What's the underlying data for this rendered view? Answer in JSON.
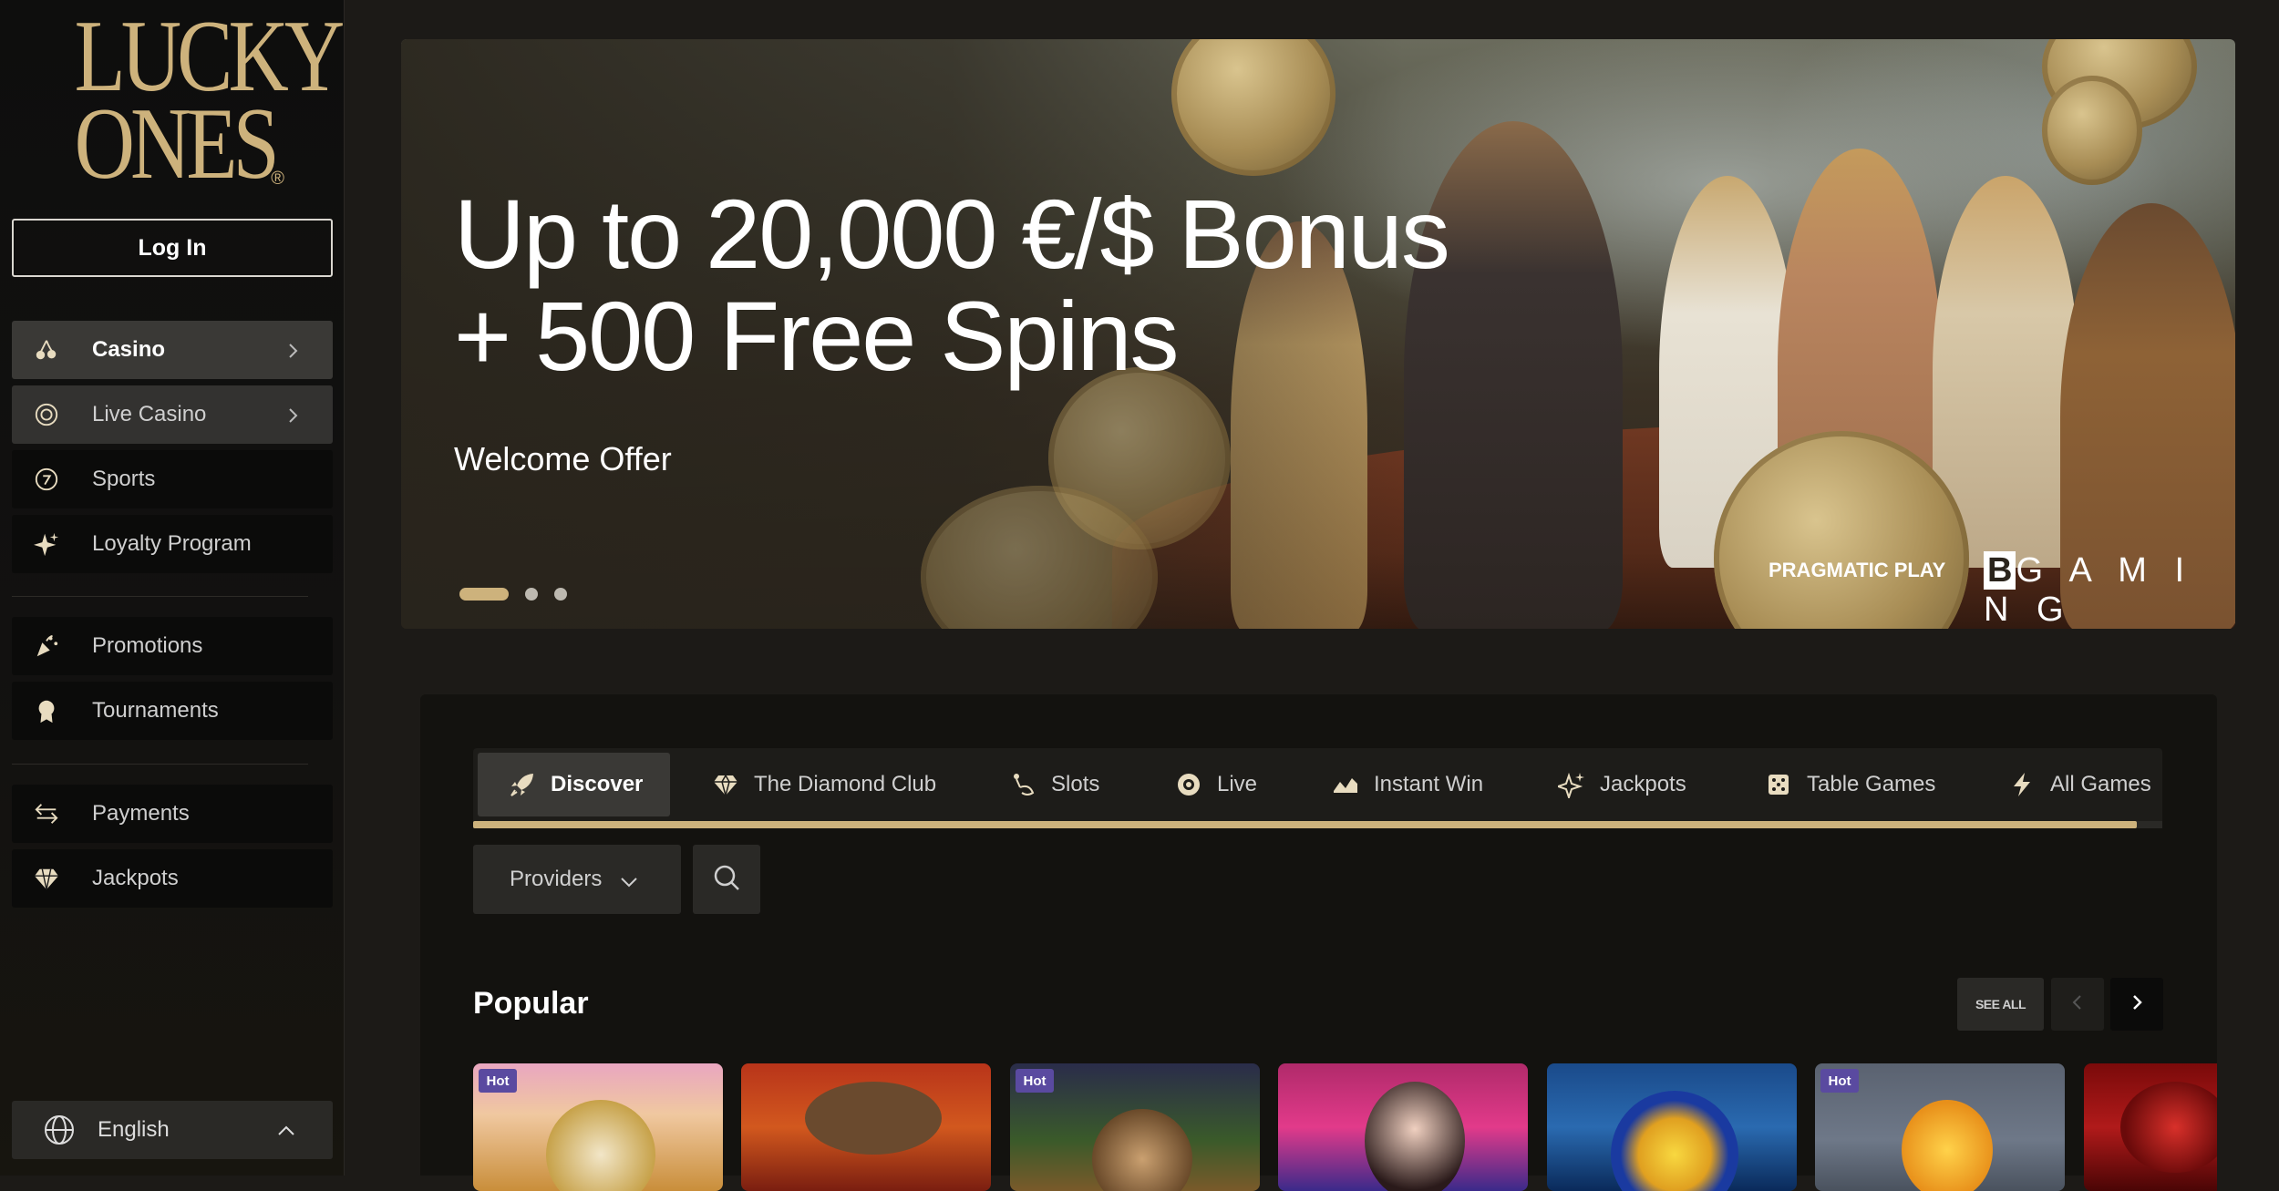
{
  "brand": {
    "logo_line1": "LUCKY",
    "logo_line2": "ONES",
    "logo_reg": "®"
  },
  "sidebar": {
    "login_label": "Log In",
    "items": [
      {
        "label": "Casino",
        "icon": "cherries-icon"
      },
      {
        "label": "Live Casino",
        "icon": "chip-icon"
      },
      {
        "label": "Sports",
        "icon": "sports-ball-icon"
      },
      {
        "label": "Loyalty Program",
        "icon": "sparkle-icon"
      },
      {
        "label": "Promotions",
        "icon": "confetti-icon"
      },
      {
        "label": "Tournaments",
        "icon": "medal-icon"
      },
      {
        "label": "Payments",
        "icon": "transfer-arrows-icon"
      },
      {
        "label": "Jackpots",
        "icon": "diamond-icon"
      }
    ],
    "language": "English"
  },
  "hero": {
    "title_line1": "Up to 20,000 €/$ Bonus",
    "title_line2": "+ 500 Free Spins",
    "subtitle": "Welcome Offer",
    "slide_count": 3,
    "active_slide": 1,
    "provider_logo_1": "PRAGMATIC PLAY",
    "provider_logo_2_initial": "B",
    "provider_logo_2_rest": "G A M I N G"
  },
  "tabs": [
    {
      "label": "Discover",
      "icon": "rocket-icon"
    },
    {
      "label": "The Diamond Club",
      "icon": "diamond-icon"
    },
    {
      "label": "Slots",
      "icon": "slot-lever-icon"
    },
    {
      "label": "Live",
      "icon": "chip-icon"
    },
    {
      "label": "Instant Win",
      "icon": "trend-icon"
    },
    {
      "label": "Jackpots",
      "icon": "sparkle-icon"
    },
    {
      "label": "Table Games",
      "icon": "dice-icon"
    },
    {
      "label": "All Games",
      "icon": "lightning-icon"
    }
  ],
  "tabs_scroll_progress": 0.985,
  "filters": {
    "providers_label": "Providers"
  },
  "popular": {
    "title": "Popular",
    "see_all": "SEE ALL",
    "games": [
      {
        "badge": "Hot"
      },
      {
        "badge": ""
      },
      {
        "badge": "Hot"
      },
      {
        "badge": ""
      },
      {
        "badge": ""
      },
      {
        "badge": "Hot"
      },
      {
        "badge": ""
      }
    ]
  },
  "colors": {
    "accent_gold": "#cdb27c",
    "background": "#1c1a17",
    "panel": "#13120f",
    "active_item": "#3a3936",
    "badge_hot": "#5a4aa0"
  }
}
